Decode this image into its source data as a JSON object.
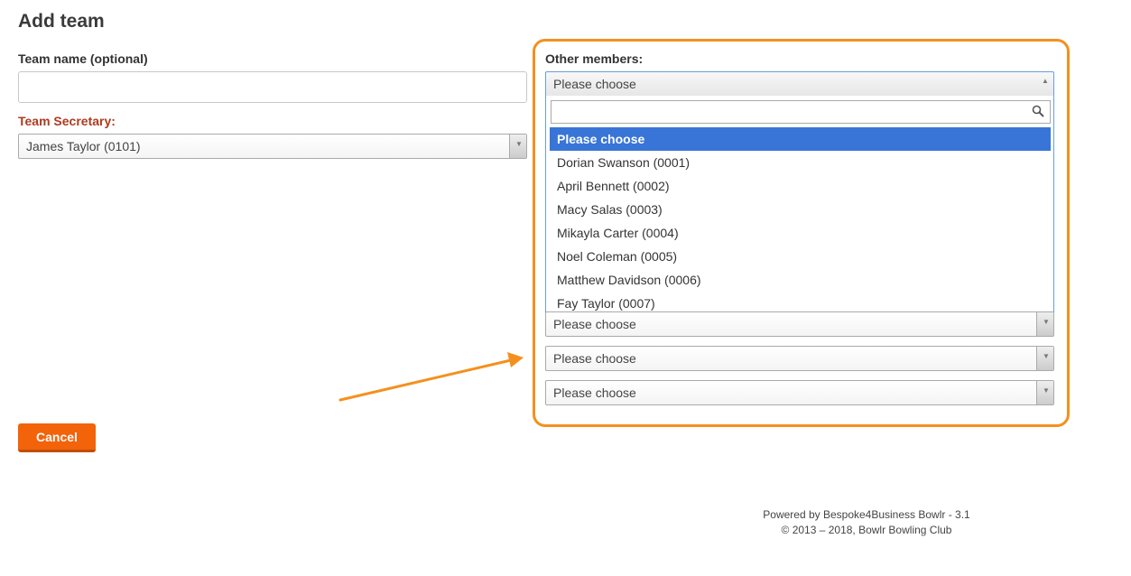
{
  "page": {
    "title": "Add team"
  },
  "form": {
    "team_name": {
      "label": "Team name (optional)",
      "value": "",
      "placeholder": ""
    },
    "team_secretary": {
      "label": "Team Secretary:",
      "value": "James Taylor (0101)"
    },
    "other_members": {
      "label": "Other members:",
      "open_select": {
        "value": "Please choose"
      },
      "search": {
        "value": "",
        "placeholder": ""
      },
      "options": [
        "Please choose",
        "Dorian Swanson (0001)",
        "April Bennett (0002)",
        "Macy Salas (0003)",
        "Mikayla Carter (0004)",
        "Noel Coleman (0005)",
        "Matthew Davidson (0006)",
        "Fay Taylor (0007)"
      ],
      "selected_option": "Please choose",
      "member_selects": [
        "Please choose",
        "Please choose",
        "Please choose"
      ]
    }
  },
  "actions": {
    "cancel_label": "Cancel"
  },
  "footer": {
    "powered_by": "Powered by Bespoke4Business Bowlr - 3.1",
    "copyright": "© 2013 – 2018, Bowlr Bowling Club"
  },
  "colors": {
    "accent_orange": "#f4901e",
    "button_orange": "#f2630a",
    "required_label": "#b03a1e",
    "selected_option_bg": "#3875d7"
  },
  "icons": {
    "search": "search-icon",
    "dropdown_arrow": "chevron-down-icon",
    "dropdown_arrow_open": "chevron-up-icon",
    "annotation": "annotation-arrow-icon"
  }
}
